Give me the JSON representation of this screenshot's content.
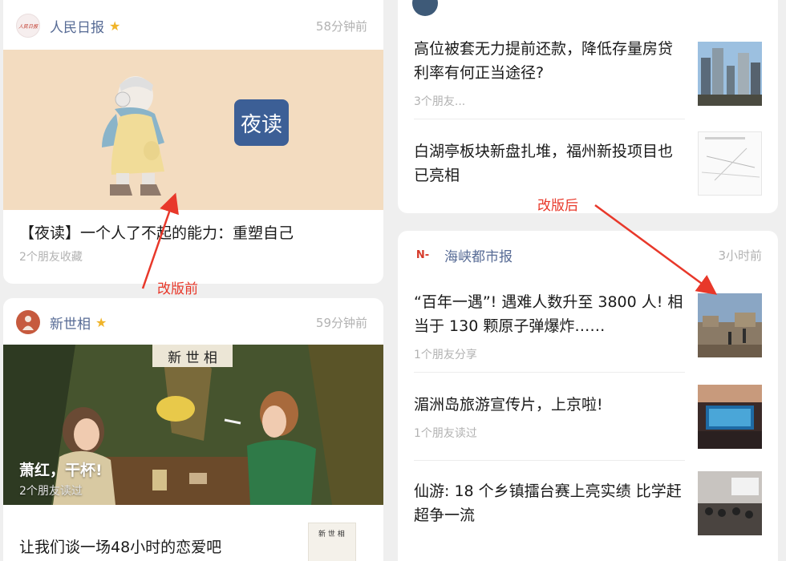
{
  "left_column": {
    "card1": {
      "source_name": "人民日报",
      "logo_text": "人民日报",
      "time": "58分钟前",
      "cover_badge": "夜读",
      "title": "【夜读】一个人了不起的能力：重塑自己",
      "meta": "2个朋友收藏"
    },
    "card2": {
      "source_name": "新世相",
      "time": "59分钟前",
      "cover_sign": "新 世 相",
      "cover_title": "萧红，干杯!",
      "cover_meta": "2个朋友读过",
      "title": "让我们谈一场48小时的恋爱吧",
      "thumb_text": "新 世 相"
    }
  },
  "right_column": {
    "card1": {
      "items": [
        {
          "title": "高位被套无力提前还款，降低存量房贷利率有何正当途径?",
          "meta": "3个朋友..."
        },
        {
          "title": "白湖亭板块新盘扎堆，福州新投项目也已亮相",
          "meta": ""
        }
      ]
    },
    "card2": {
      "source_name": "海峡都市报",
      "logo_text": "N-",
      "time": "3小时前",
      "items": [
        {
          "title": "“百年一遇”! 遇难人数升至 3800 人! 相当于 130 颗原子弹爆炸……",
          "meta": "1个朋友分享"
        },
        {
          "title": "湄洲岛旅游宣传片，上京啦!",
          "meta": "1个朋友读过"
        },
        {
          "title": "仙游: 18 个乡镇擂台赛上亮实绩 比学赶超争一流",
          "meta": ""
        }
      ]
    }
  },
  "annotations": {
    "before": "改版前",
    "after": "改版后"
  },
  "colors": {
    "source_name": "#576b95",
    "annotation": "#e8382a",
    "star": "#f0b429"
  }
}
